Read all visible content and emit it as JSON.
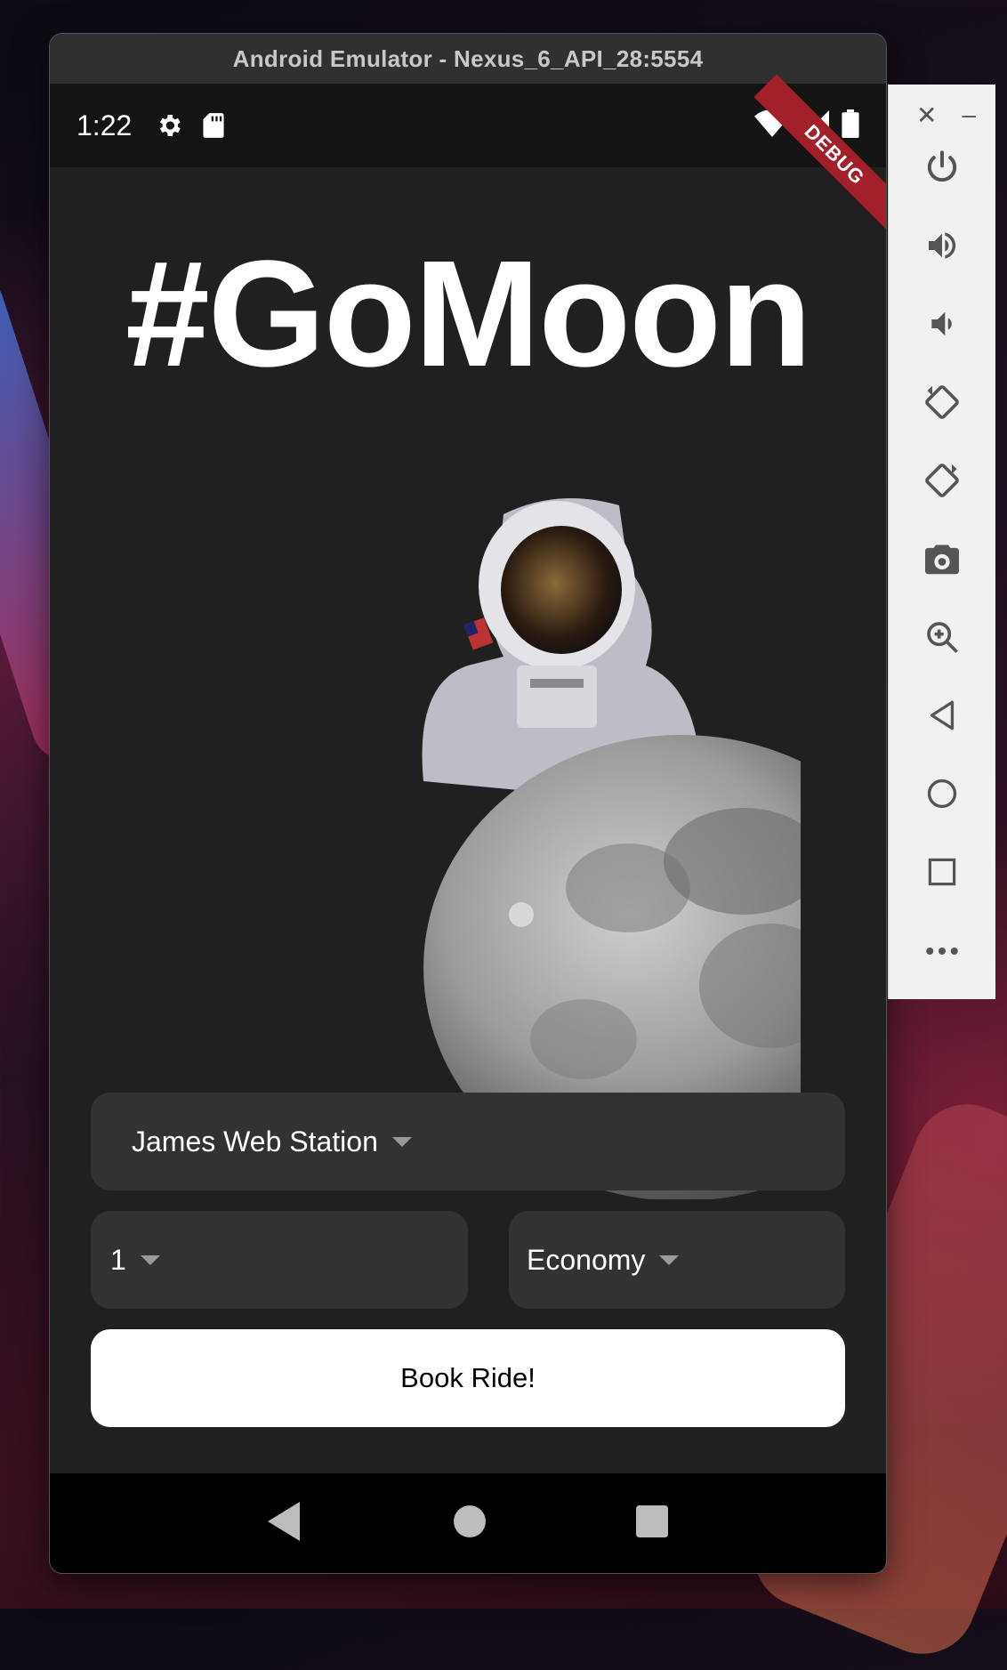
{
  "window": {
    "title": "Android Emulator - Nexus_6_API_28:5554"
  },
  "status_bar": {
    "time": "1:22"
  },
  "debug_banner": "DEBUG",
  "app": {
    "headline": "#GoMoon",
    "destination_dropdown": {
      "value": "James Web Station"
    },
    "travellers_dropdown": {
      "value": "1"
    },
    "class_dropdown": {
      "value": "Economy"
    },
    "book_button": "Book Ride!"
  },
  "toolbar": {
    "icons": [
      "close-icon",
      "minimize-icon",
      "power-icon",
      "volume-up-icon",
      "volume-down-icon",
      "rotate-left-icon",
      "rotate-right-icon",
      "camera-icon",
      "zoom-icon",
      "back-icon",
      "home-icon",
      "overview-icon",
      "more-icon"
    ]
  },
  "colors": {
    "app_bg": "#202020",
    "field_bg": "#323232",
    "button_bg": "#ffffff",
    "debug_banner": "#a3202a"
  }
}
